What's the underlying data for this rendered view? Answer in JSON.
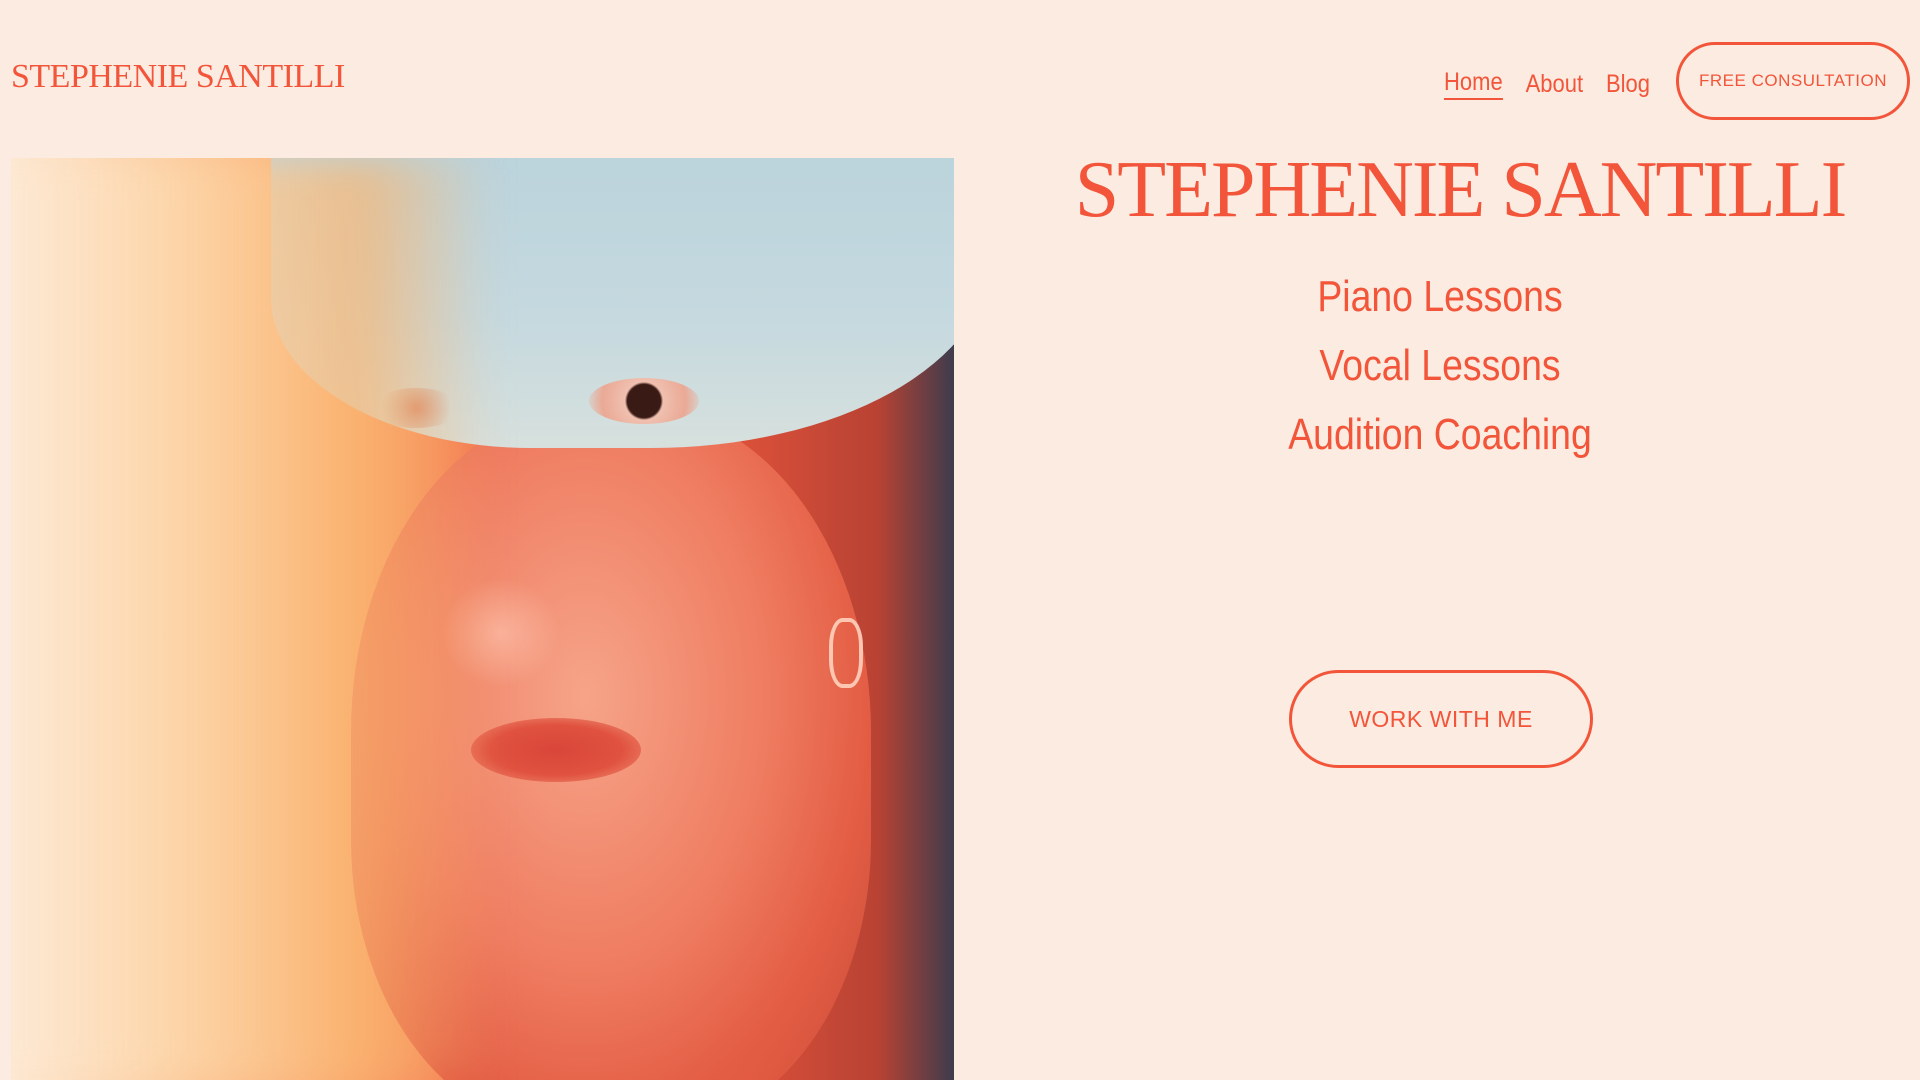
{
  "header": {
    "site_title": "STEPHENIE SANTILLI",
    "nav": [
      {
        "label": "Home",
        "active": true
      },
      {
        "label": "About",
        "active": false
      },
      {
        "label": "Blog",
        "active": false
      }
    ],
    "cta_label": "FREE CONSULTATION"
  },
  "hero": {
    "title": "STEPHENIE SANTILLI",
    "services": [
      "Piano Lessons",
      "Vocal Lessons",
      "Audition Coaching"
    ],
    "button_label": "WORK WITH ME"
  },
  "colors": {
    "background": "#fcebe0",
    "accent": "#f2553a"
  }
}
